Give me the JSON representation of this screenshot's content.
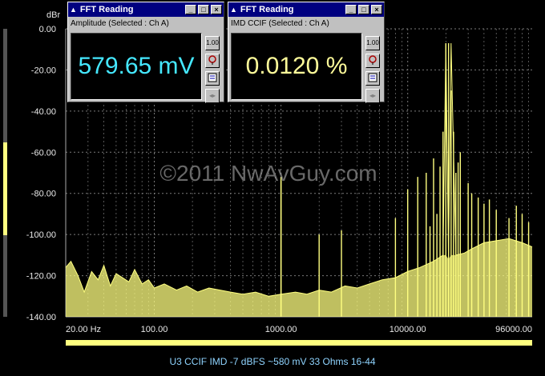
{
  "windows": [
    {
      "title": "FFT Reading",
      "subtitle": "Amplitude (Selected : Ch A)",
      "value": "579.65 mV",
      "value_color": "#45e8ff"
    },
    {
      "title": "FFT Reading",
      "subtitle": "IMD CCIF (Selected : Ch A)",
      "value": "0.0120 %",
      "value_color": "#fffc9a"
    }
  ],
  "window_controls": {
    "minimize": "_",
    "maximize": "□",
    "close": "×"
  },
  "window_tool_icons": [
    "scale-1.00-icon",
    "probe-icon",
    "notepad-icon",
    "arrows-icon"
  ],
  "scale_button_label": "1.00",
  "watermark": "©2011 NwAvGuy.com",
  "caption": "U3 CCIF IMD -7 dBFS ~580 mV 33 Ohms 16-44",
  "level_meter": {
    "level_fraction": 0.32
  },
  "colors": {
    "trace": "#ffff80",
    "grid": "#7a7a7a",
    "background": "#000000",
    "bottom_bar": "#ffff80"
  },
  "chart_data": {
    "type": "line",
    "title": "",
    "ylabel_unit": "dBr",
    "x_scale": "log",
    "xlim": [
      20,
      96000
    ],
    "ylim": [
      -140,
      0
    ],
    "grid": true,
    "x_tick_labels": [
      {
        "value": 20,
        "label": "20.00 Hz"
      },
      {
        "value": 100,
        "label": "100.00"
      },
      {
        "value": 1000,
        "label": "1000.00"
      },
      {
        "value": 10000,
        "label": "10000.00"
      },
      {
        "value": 96000,
        "label": "96000.00"
      }
    ],
    "y_ticks": [
      0,
      -20,
      -40,
      -60,
      -80,
      -100,
      -120,
      -140
    ],
    "y_tick_labels": [
      "0.00",
      "-20.00",
      "-40.00",
      "-60.00",
      "-80.00",
      "-100.00",
      "-120.00",
      "-140.00"
    ],
    "series": [
      {
        "x": [
          20,
          22,
          25,
          28,
          32,
          36,
          40,
          45,
          50,
          56,
          63,
          70,
          80,
          90,
          100,
          120,
          150,
          180,
          220,
          270,
          330,
          400,
          500,
          630,
          800,
          1000,
          1300,
          1600,
          2000,
          2500,
          3200,
          4000,
          5000,
          6300,
          8000,
          10000,
          12500,
          16000,
          19000,
          20000,
          21000,
          22000,
          24000,
          28000,
          32000,
          40000,
          50000,
          63000,
          80000,
          96000
        ],
        "y": [
          -116,
          -113,
          -120,
          -128,
          -118,
          -122,
          -115,
          -125,
          -119,
          -121,
          -123,
          -117,
          -124,
          -122,
          -126,
          -124,
          -127,
          -125,
          -128,
          -126,
          -127,
          -128,
          -129,
          -128,
          -130,
          -129,
          -128,
          -129,
          -127,
          -128,
          -125,
          -126,
          -124,
          -122,
          -121,
          -118,
          -116,
          -113,
          -110,
          -7,
          -112,
          -7,
          -110,
          -109,
          -107,
          -104,
          -103,
          -102,
          -104,
          -106
        ]
      }
    ],
    "peaks": [
      {
        "x": 1000,
        "y": -72
      },
      {
        "x": 1000,
        "y": -74
      },
      {
        "x": 2000,
        "y": -100
      },
      {
        "x": 3000,
        "y": -98
      },
      {
        "x": 8000,
        "y": -92
      },
      {
        "x": 10000,
        "y": -78
      },
      {
        "x": 12000,
        "y": -72
      },
      {
        "x": 14000,
        "y": -70
      },
      {
        "x": 15000,
        "y": -96
      },
      {
        "x": 16000,
        "y": -63
      },
      {
        "x": 17000,
        "y": -90
      },
      {
        "x": 18000,
        "y": -67
      },
      {
        "x": 19000,
        "y": -50
      },
      {
        "x": 20000,
        "y": -7
      },
      {
        "x": 21000,
        "y": -7
      },
      {
        "x": 22000,
        "y": -30
      },
      {
        "x": 23000,
        "y": -50
      },
      {
        "x": 24000,
        "y": -70
      },
      {
        "x": 25000,
        "y": -65
      },
      {
        "x": 26000,
        "y": -60
      },
      {
        "x": 30000,
        "y": -75
      },
      {
        "x": 32000,
        "y": -80
      },
      {
        "x": 36000,
        "y": -82
      },
      {
        "x": 40000,
        "y": -85
      },
      {
        "x": 44100,
        "y": -83
      },
      {
        "x": 50000,
        "y": -88
      },
      {
        "x": 63000,
        "y": -92
      },
      {
        "x": 72000,
        "y": -86
      },
      {
        "x": 80000,
        "y": -90
      },
      {
        "x": 90000,
        "y": -94
      }
    ]
  }
}
